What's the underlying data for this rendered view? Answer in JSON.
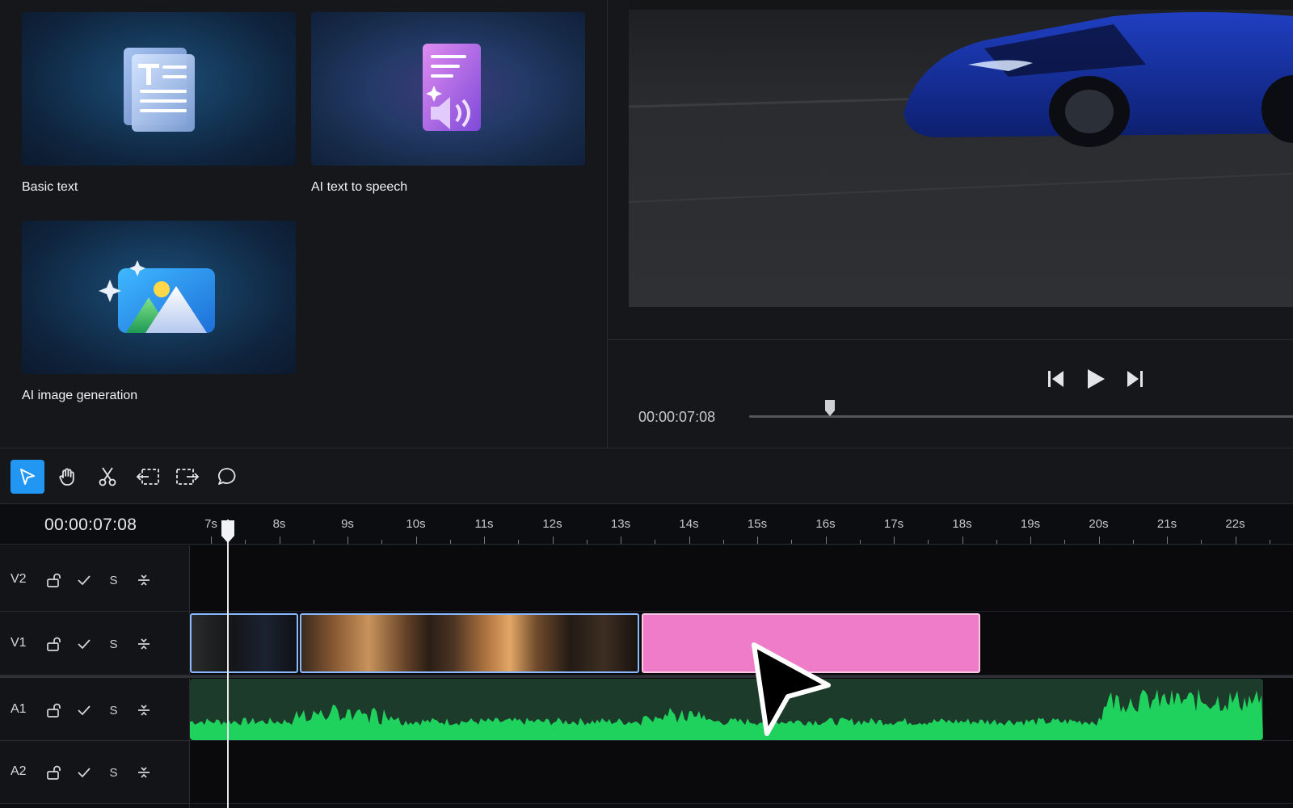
{
  "media": {
    "cards": [
      {
        "label": "Basic text",
        "icon": "text-document-icon"
      },
      {
        "label": "AI text to speech",
        "icon": "speech-document-icon"
      },
      {
        "label": "AI image generation",
        "icon": "image-sparkle-icon"
      }
    ]
  },
  "preview": {
    "timecode": "00:00:07:08",
    "progress": 0.14
  },
  "toolbar": {
    "tools": [
      "select-tool",
      "hand-tool",
      "cut-tool",
      "trim-left-tool",
      "trim-right-tool",
      "comment-tool"
    ],
    "active_tool": "select-tool",
    "accent_color": "#2196f3"
  },
  "timeline": {
    "timecode": "00:00:07:08",
    "ruler_labels": [
      "7s",
      "8s",
      "9s",
      "10s",
      "11s",
      "12s",
      "13s",
      "14s",
      "15s",
      "16s",
      "17s",
      "18s",
      "19s",
      "20s",
      "21s",
      "22s"
    ],
    "tracks": [
      {
        "name": "V2",
        "solo": "S"
      },
      {
        "name": "V1",
        "solo": "S"
      },
      {
        "name": "A1",
        "solo": "S"
      },
      {
        "name": "A2",
        "solo": "S"
      }
    ],
    "clip_colors": {
      "pink": "#ee7cc8",
      "audio": "#1fd15d"
    }
  }
}
